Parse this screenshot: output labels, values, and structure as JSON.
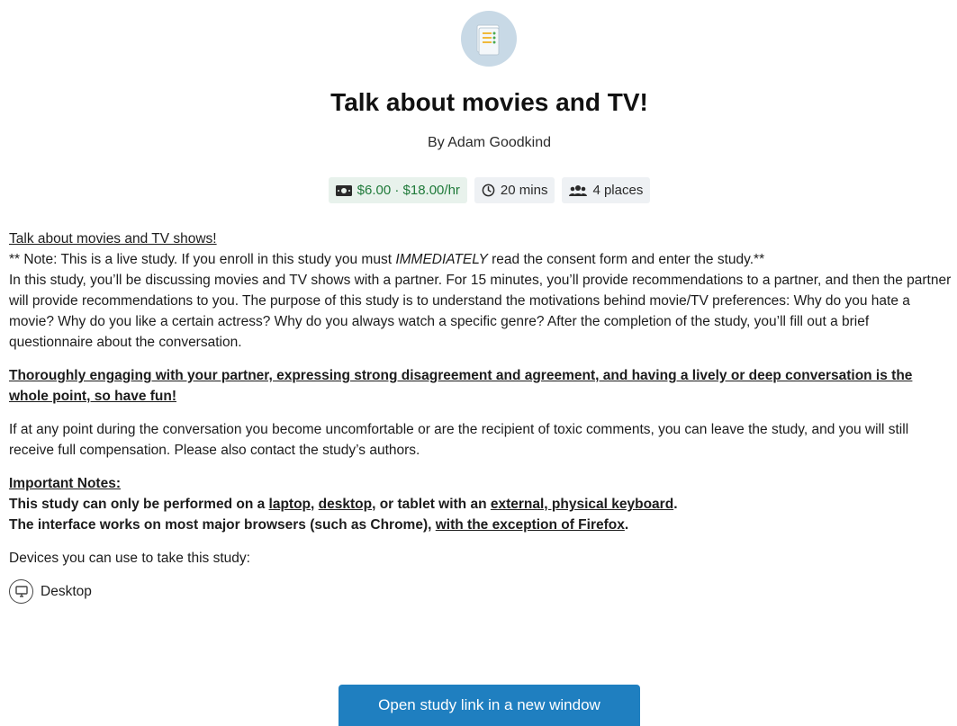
{
  "study": {
    "title": "Talk about movies and TV!",
    "author": "By Adam Goodkind",
    "reward": "$6.00 · $18.00/hr",
    "duration": "20 mins",
    "places": "4 places"
  },
  "description": {
    "heading": "Talk about movies and TV shows!",
    "note_prefix": "** Note: This is a live study. If you enroll in this study you must ",
    "note_emph": "IMMEDIATELY",
    "note_suffix": " read the consent form and enter the study.**",
    "body": "In this study, you’ll be discussing movies and TV shows with a partner. For 15 minutes, you’ll provide recommendations to a partner, and then the partner will provide recommendations to you. The purpose of this study is to understand the motivations behind movie/TV preferences: Why do you hate a movie? Why do you like a certain actress? Why do you always watch a specific genre? After the completion of the study, you’ll fill out a brief questionnaire about the conversation.",
    "emphasis": "Thoroughly engaging with your partner, expressing strong disagreement and agreement, and having a lively or deep conversation is the whole point, so have fun!",
    "toxic_note": "If at any point during the conversation you become uncomfortable or are the recipient of toxic comments, you can leave the study, and you will still receive full compensation. Please also contact the study’s authors.",
    "important_heading": "Important Notes:",
    "device_line": {
      "prefix": "This study can only be performed on a ",
      "laptop": "laptop",
      "sep1": ", ",
      "desktop": "desktop",
      "mid": ", or tablet with an ",
      "keyboard": "external, physical keyboard",
      "end": "."
    },
    "browser_line": {
      "prefix": "The interface works on most major browsers (such as Chrome), ",
      "firefox": "with the exception of Firefox",
      "end": "."
    }
  },
  "devices": {
    "title": "Devices you can use to take this study:",
    "items": [
      "Desktop"
    ]
  },
  "cta": {
    "label": "Open study link in a new window"
  },
  "icons": {
    "study": "document-icon",
    "reward": "money-icon",
    "duration": "clock-icon",
    "places": "users-icon",
    "device": "monitor-icon"
  },
  "colors": {
    "accent": "#1f7fc0",
    "reward": "#1f7a3a"
  }
}
